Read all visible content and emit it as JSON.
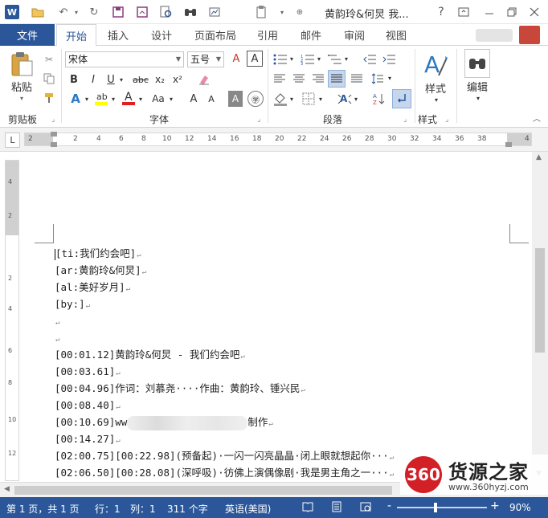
{
  "titlebar": {
    "title": "黄韵玲&何炅 我...",
    "help": "?",
    "icons": [
      "word-icon",
      "open-icon",
      "undo-icon",
      "redo-icon",
      "save-icon",
      "save-as-icon",
      "print-preview-icon",
      "find-icon",
      "paste-icon"
    ]
  },
  "tabs": {
    "file": "文件",
    "items": [
      "开始",
      "插入",
      "设计",
      "页面布局",
      "引用",
      "邮件",
      "审阅",
      "视图"
    ]
  },
  "ribbon": {
    "clipboard": {
      "paste": "粘贴",
      "label": "剪贴板"
    },
    "font": {
      "name": "宋体",
      "size": "五号",
      "label": "字体",
      "bold": "B",
      "italic": "I",
      "underline": "U",
      "strike": "abc",
      "sub": "x₂",
      "sup": "x²",
      "change_case": "Aa",
      "grow": "A",
      "shrink": "A",
      "char_shade": "A",
      "enclose": "㊫",
      "phonetic": "A"
    },
    "paragraph": {
      "label": "段落"
    },
    "styles": {
      "big": "样式",
      "label": "样式"
    },
    "editing": {
      "big": "编辑"
    }
  },
  "ruler": {
    "tab_selector": "L",
    "ticks": [
      "2",
      "2",
      "4",
      "6",
      "8",
      "10",
      "12",
      "14",
      "16",
      "18",
      "20",
      "22",
      "24",
      "26",
      "28",
      "30",
      "32",
      "34",
      "36",
      "38",
      "4"
    ],
    "vticks": [
      "4",
      "2",
      "2",
      "4",
      "6",
      "8",
      "10",
      "12"
    ]
  },
  "document": {
    "lines": [
      "[ti:我们约会吧]",
      "[ar:黄韵玲&何炅]",
      "[al:美好岁月]",
      "[by:]",
      "",
      "",
      "[00:01.12]黄韵玲&何炅 - 我们约会吧",
      "[00:03.61]",
      "[00:04.96]作词：刘慕尧····作曲：黄韵玲、锺兴民",
      "[00:08.40]",
      "[00:10.69]ww",
      "[00:14.27]",
      "[02:00.75][00:22.98](预备起)·一闪一闪亮晶晶·闭上眼就想起你···",
      "[02:06.50][00:28.08](深呼吸)·彷佛上演偶像剧·我是男主角之一···"
    ],
    "blurred_suffix": "制作"
  },
  "watermark": {
    "logo_text": "360",
    "title": "货源之家",
    "url": "www.360hyzj.com"
  },
  "status": {
    "page": "第 1 页，共 1 页",
    "row": "行：1",
    "col": "列：1",
    "words": "311 个字",
    "lang": "英语(美国)",
    "zoom_minus": "-",
    "zoom_plus": "+",
    "zoom": "90%"
  }
}
